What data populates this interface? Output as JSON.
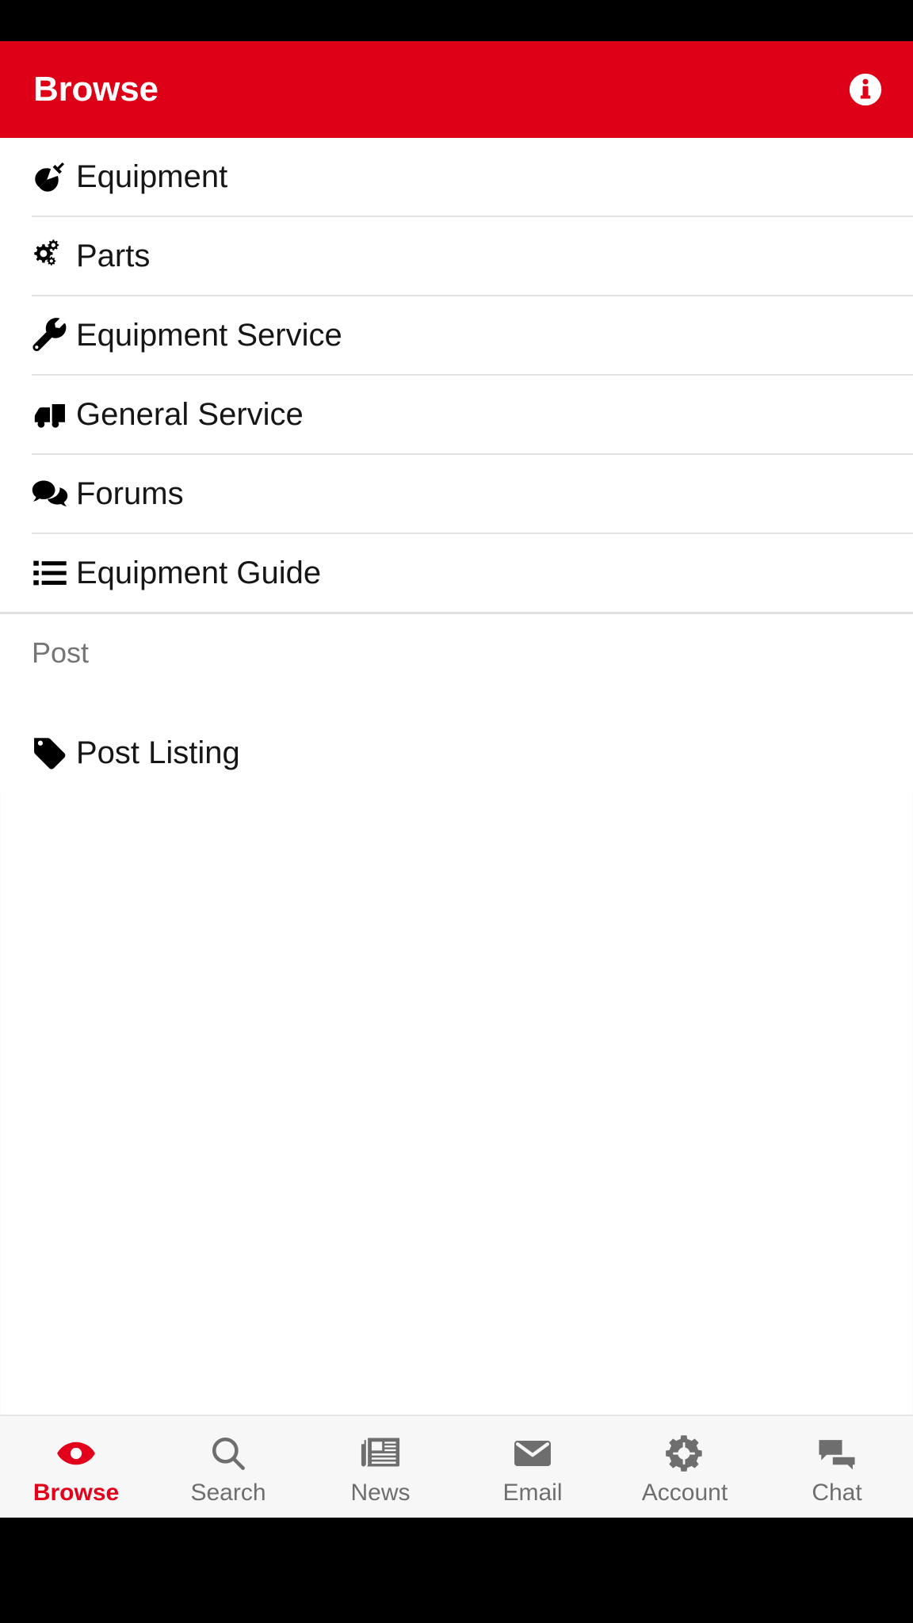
{
  "theme": {
    "brand_red": "#DD0016",
    "accent_red": "#E2001A",
    "text_dark": "#161616",
    "text_muted": "#757575",
    "nav_inactive": "#6e6e6e",
    "divider": "#e2e2e2",
    "nav_background": "#f7f7f7",
    "system_bar": "#000000"
  },
  "app_bar": {
    "title": "Browse",
    "info_icon": "info-circle-icon"
  },
  "browse_list": [
    {
      "label": "Equipment",
      "icon": "plug-icon"
    },
    {
      "label": "Parts",
      "icon": "cogs-icon"
    },
    {
      "label": "Equipment Service",
      "icon": "wrench-icon"
    },
    {
      "label": "General Service",
      "icon": "truck-icon"
    },
    {
      "label": "Forums",
      "icon": "comments-icon"
    },
    {
      "label": "Equipment Guide",
      "icon": "list-ul-icon"
    }
  ],
  "post_section": {
    "header": "Post",
    "items": [
      {
        "label": "Post Listing",
        "icon": "tag-icon"
      }
    ]
  },
  "bottom_nav": {
    "active": "Browse",
    "items": [
      {
        "label": "Browse",
        "icon": "eye-icon",
        "active": true
      },
      {
        "label": "Search",
        "icon": "search-icon",
        "active": false
      },
      {
        "label": "News",
        "icon": "newspaper-icon",
        "active": false
      },
      {
        "label": "Email",
        "icon": "envelope-icon",
        "active": false
      },
      {
        "label": "Account",
        "icon": "gear-icon",
        "active": false
      },
      {
        "label": "Chat",
        "icon": "chat-icon",
        "active": false
      }
    ]
  }
}
